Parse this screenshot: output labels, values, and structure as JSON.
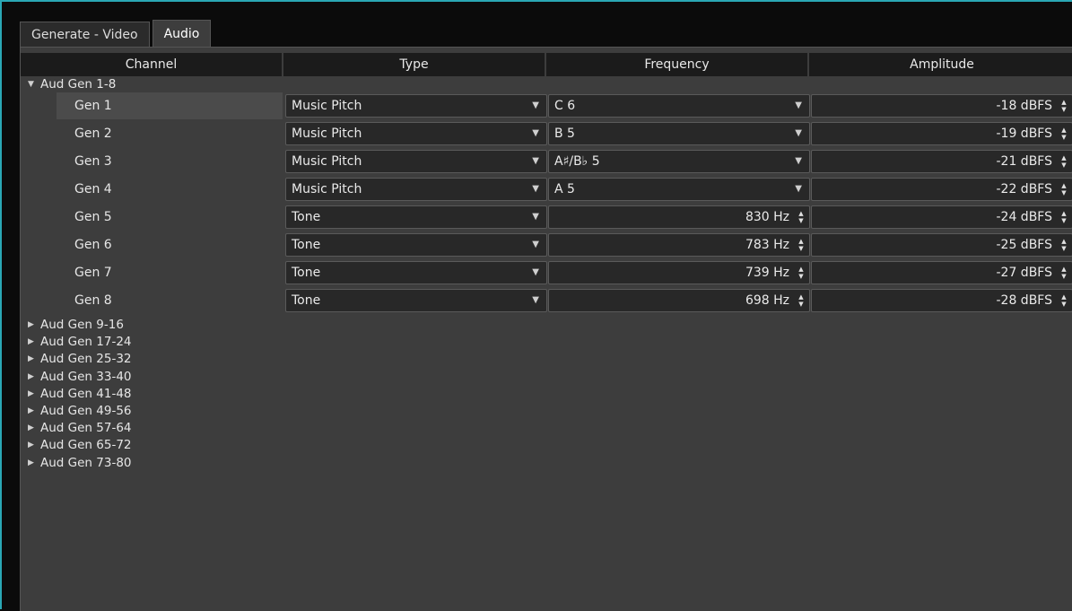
{
  "tabs": [
    {
      "label": "Generate - Video",
      "active": false
    },
    {
      "label": "Audio",
      "active": true
    }
  ],
  "table": {
    "columns": [
      "Channel",
      "Type",
      "Frequency",
      "Amplitude"
    ],
    "expanded_group": {
      "label": "Aud Gen 1-8",
      "icon": "triangle-down-icon"
    },
    "rows": [
      {
        "channel": "Gen 1",
        "type": "Music Pitch",
        "frequency": "C 6",
        "frequency_kind": "dropdown",
        "amplitude": "-18 dBFS",
        "selected": true
      },
      {
        "channel": "Gen 2",
        "type": "Music Pitch",
        "frequency": "B 5",
        "frequency_kind": "dropdown",
        "amplitude": "-19 dBFS"
      },
      {
        "channel": "Gen 3",
        "type": "Music Pitch",
        "frequency": "A♯/B♭ 5",
        "frequency_kind": "dropdown",
        "amplitude": "-21 dBFS"
      },
      {
        "channel": "Gen 4",
        "type": "Music Pitch",
        "frequency": "A 5",
        "frequency_kind": "dropdown",
        "amplitude": "-22 dBFS"
      },
      {
        "channel": "Gen 5",
        "type": "Tone",
        "frequency": "830 Hz",
        "frequency_kind": "spinbox",
        "amplitude": "-24 dBFS"
      },
      {
        "channel": "Gen 6",
        "type": "Tone",
        "frequency": "783 Hz",
        "frequency_kind": "spinbox",
        "amplitude": "-25 dBFS"
      },
      {
        "channel": "Gen 7",
        "type": "Tone",
        "frequency": "739 Hz",
        "frequency_kind": "spinbox",
        "amplitude": "-27 dBFS"
      },
      {
        "channel": "Gen 8",
        "type": "Tone",
        "frequency": "698 Hz",
        "frequency_kind": "spinbox",
        "amplitude": "-28 dBFS"
      }
    ],
    "collapsed_groups": [
      "Aud Gen 9-16",
      "Aud Gen 17-24",
      "Aud Gen 25-32",
      "Aud Gen 33-40",
      "Aud Gen 41-48",
      "Aud Gen 49-56",
      "Aud Gen 57-64",
      "Aud Gen 65-72",
      "Aud Gen 73-80"
    ]
  },
  "icons": {
    "dropdown": "chevron-down-icon",
    "spinner": "up-down-spinner-icon",
    "collapsed": "triangle-right-icon"
  },
  "colors": {
    "accent_border": "#2aa7b4",
    "panel_bg": "#3d3d3d",
    "header_bg": "#1b1b1b",
    "control_bg": "#282828"
  }
}
